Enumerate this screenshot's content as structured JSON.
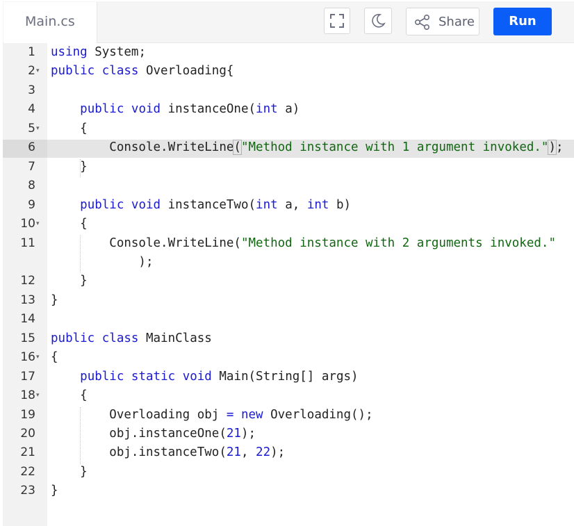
{
  "editor": {
    "tab_label": "Main.cs",
    "toolbar": {
      "fullscreen_icon": "fullscreen-icon",
      "theme_icon": "moon-icon",
      "share_icon": "share-icon",
      "share_label": "Share",
      "run_label": "Run",
      "run_color": "#0a5ef7"
    },
    "active_line": 6,
    "lines": [
      {
        "n": "1",
        "fold": false,
        "tokens": [
          {
            "t": "kw",
            "v": "using"
          },
          {
            "t": "",
            "v": " System;"
          }
        ]
      },
      {
        "n": "2",
        "fold": true,
        "tokens": [
          {
            "t": "kw",
            "v": "public"
          },
          {
            "t": "",
            "v": " "
          },
          {
            "t": "kw",
            "v": "class"
          },
          {
            "t": "",
            "v": " Overloading{"
          }
        ]
      },
      {
        "n": "3",
        "fold": false,
        "tokens": []
      },
      {
        "n": "4",
        "fold": false,
        "tokens": [
          {
            "t": "",
            "v": "    "
          },
          {
            "t": "kw",
            "v": "public"
          },
          {
            "t": "",
            "v": " "
          },
          {
            "t": "kw",
            "v": "void"
          },
          {
            "t": "",
            "v": " instanceOne("
          },
          {
            "t": "kw",
            "v": "int"
          },
          {
            "t": "",
            "v": " a)"
          }
        ]
      },
      {
        "n": "5",
        "fold": true,
        "tokens": [
          {
            "t": "",
            "v": "    {"
          }
        ]
      },
      {
        "n": "6",
        "fold": false,
        "tokens": [
          {
            "t": "",
            "v": "        Console.WriteLine"
          },
          {
            "t": "br",
            "v": "("
          },
          {
            "t": "str",
            "v": "\"Method instance with 1 argument invoked.\""
          },
          {
            "t": "br",
            "v": ")"
          },
          {
            "t": "",
            "v": ";"
          }
        ]
      },
      {
        "n": "7",
        "fold": false,
        "tokens": [
          {
            "t": "",
            "v": "    }"
          }
        ]
      },
      {
        "n": "8",
        "fold": false,
        "tokens": []
      },
      {
        "n": "9",
        "fold": false,
        "tokens": [
          {
            "t": "",
            "v": "    "
          },
          {
            "t": "kw",
            "v": "public"
          },
          {
            "t": "",
            "v": " "
          },
          {
            "t": "kw",
            "v": "void"
          },
          {
            "t": "",
            "v": " instanceTwo("
          },
          {
            "t": "kw",
            "v": "int"
          },
          {
            "t": "",
            "v": " a, "
          },
          {
            "t": "kw",
            "v": "int"
          },
          {
            "t": "",
            "v": " b)"
          }
        ]
      },
      {
        "n": "10",
        "fold": true,
        "tokens": [
          {
            "t": "",
            "v": "    {"
          }
        ]
      },
      {
        "n": "11",
        "fold": false,
        "tokens": [
          {
            "t": "",
            "v": "        Console.WriteLine("
          },
          {
            "t": "str",
            "v": "\"Method instance with 2 arguments invoked.\""
          }
        ]
      },
      {
        "n": "",
        "fold": false,
        "tokens": [
          {
            "t": "",
            "v": "            );"
          }
        ]
      },
      {
        "n": "12",
        "fold": false,
        "tokens": [
          {
            "t": "",
            "v": "    }"
          }
        ]
      },
      {
        "n": "13",
        "fold": false,
        "tokens": [
          {
            "t": "",
            "v": "}"
          }
        ]
      },
      {
        "n": "14",
        "fold": false,
        "tokens": []
      },
      {
        "n": "15",
        "fold": false,
        "tokens": [
          {
            "t": "kw",
            "v": "public"
          },
          {
            "t": "",
            "v": " "
          },
          {
            "t": "kw",
            "v": "class"
          },
          {
            "t": "",
            "v": " MainClass"
          }
        ]
      },
      {
        "n": "16",
        "fold": true,
        "tokens": [
          {
            "t": "",
            "v": "{"
          }
        ]
      },
      {
        "n": "17",
        "fold": false,
        "tokens": [
          {
            "t": "",
            "v": "    "
          },
          {
            "t": "kw",
            "v": "public"
          },
          {
            "t": "",
            "v": " "
          },
          {
            "t": "kw",
            "v": "static"
          },
          {
            "t": "",
            "v": " "
          },
          {
            "t": "kw",
            "v": "void"
          },
          {
            "t": "",
            "v": " Main(String[] args)"
          }
        ]
      },
      {
        "n": "18",
        "fold": true,
        "tokens": [
          {
            "t": "",
            "v": "    {"
          }
        ]
      },
      {
        "n": "19",
        "fold": false,
        "tokens": [
          {
            "t": "",
            "v": "        Overloading obj "
          },
          {
            "t": "kw",
            "v": "="
          },
          {
            "t": "",
            "v": " "
          },
          {
            "t": "kw",
            "v": "new"
          },
          {
            "t": "",
            "v": " Overloading();"
          }
        ]
      },
      {
        "n": "20",
        "fold": false,
        "tokens": [
          {
            "t": "",
            "v": "        obj.instanceOne("
          },
          {
            "t": "num",
            "v": "21"
          },
          {
            "t": "",
            "v": ");"
          }
        ]
      },
      {
        "n": "21",
        "fold": false,
        "tokens": [
          {
            "t": "",
            "v": "        obj.instanceTwo("
          },
          {
            "t": "num",
            "v": "21"
          },
          {
            "t": "",
            "v": ", "
          },
          {
            "t": "num",
            "v": "22"
          },
          {
            "t": "",
            "v": ");"
          }
        ]
      },
      {
        "n": "22",
        "fold": false,
        "tokens": [
          {
            "t": "",
            "v": "    }"
          }
        ]
      },
      {
        "n": "23",
        "fold": false,
        "tokens": [
          {
            "t": "",
            "v": "}"
          }
        ]
      }
    ]
  }
}
